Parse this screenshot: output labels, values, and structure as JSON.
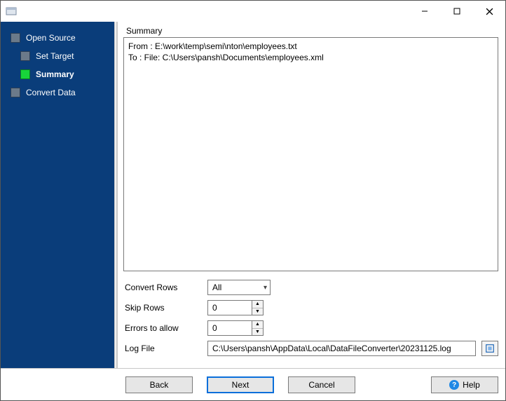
{
  "titlebar": {
    "title": ""
  },
  "sidebar": {
    "items": [
      {
        "label": "Open Source",
        "active": false,
        "sub": false
      },
      {
        "label": "Set Target",
        "active": false,
        "sub": true
      },
      {
        "label": "Summary",
        "active": true,
        "sub": true
      },
      {
        "label": "Convert Data",
        "active": false,
        "sub": false
      }
    ]
  },
  "main": {
    "group_title": "Summary",
    "summary_text": "From : E:\\work\\temp\\semi\\nton\\employees.txt\nTo : File: C:\\Users\\pansh\\Documents\\employees.xml",
    "rows": {
      "convert_rows_label": "Convert Rows",
      "convert_rows_value": "All",
      "skip_rows_label": "Skip Rows",
      "skip_rows_value": "0",
      "errors_label": "Errors to allow",
      "errors_value": "0",
      "log_label": "Log File",
      "log_value": "C:\\Users\\pansh\\AppData\\Local\\DataFileConverter\\20231125.log"
    }
  },
  "buttons": {
    "back": "Back",
    "next": "Next",
    "cancel": "Cancel",
    "help": "Help"
  }
}
